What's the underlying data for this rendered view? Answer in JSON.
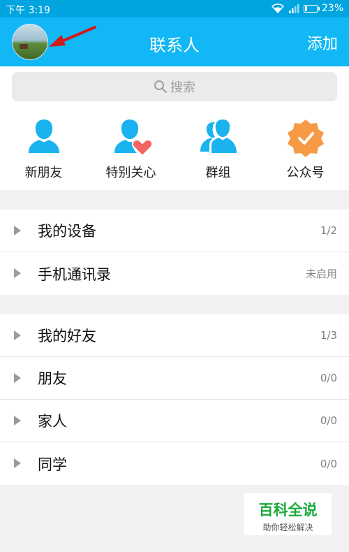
{
  "status": {
    "time": "下午 3:19",
    "battery": "23%",
    "battery_level": 0.23
  },
  "header": {
    "title": "联系人",
    "add_label": "添加"
  },
  "search": {
    "placeholder": "搜索"
  },
  "shortcuts": [
    {
      "label": "新朋友",
      "icon": "person-icon"
    },
    {
      "label": "特别关心",
      "icon": "person-heart-icon"
    },
    {
      "label": "群组",
      "icon": "group-icon"
    },
    {
      "label": "公众号",
      "icon": "verified-badge-icon"
    }
  ],
  "groups_top": [
    {
      "name": "我的设备",
      "count": "1/2"
    },
    {
      "name": "手机通讯录",
      "count": "未启用"
    }
  ],
  "groups_friends": [
    {
      "name": "我的好友",
      "count": "1/3"
    },
    {
      "name": "朋友",
      "count": "0/0"
    },
    {
      "name": "家人",
      "count": "0/0"
    },
    {
      "name": "同学",
      "count": "0/0"
    }
  ],
  "watermark": {
    "title": "百科全说",
    "subtitle": "助你轻松解决"
  },
  "colors": {
    "header": "#12b7f5",
    "statusbar": "#00a5e0",
    "icon_blue": "#1ab2ef",
    "heart": "#f26565",
    "badge": "#f79a45"
  }
}
